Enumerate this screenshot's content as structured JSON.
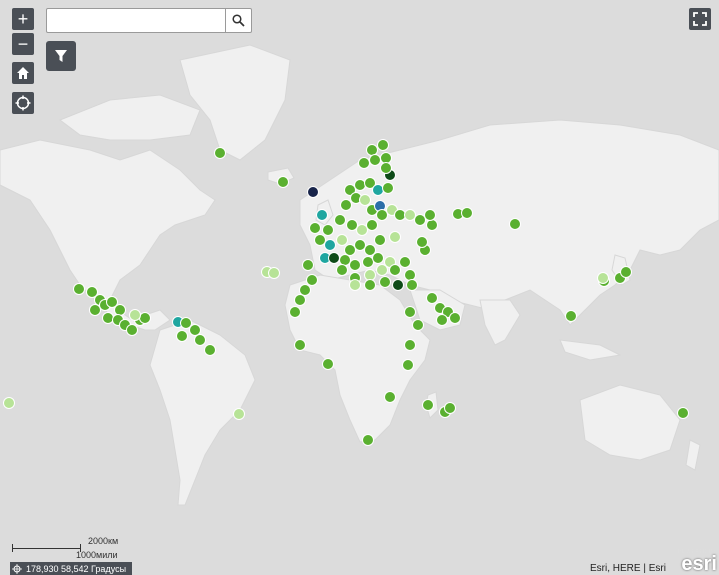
{
  "map": {
    "marker_colors": {
      "primary": "#5ab030",
      "light": "#b7e397",
      "teal": "#1fa6a0",
      "blue": "#2b6ea8",
      "dark": "#0e4b18",
      "navy": "#18244a",
      "outline": "#ffffff"
    },
    "land_color": "#f0f0f0",
    "ocean_color": "#dcdcdc"
  },
  "controls": {
    "zoom_in_label": "+",
    "zoom_out_label": "−",
    "home_icon": "home-icon",
    "locate_icon": "locate-icon",
    "fullscreen_icon": "fullscreen-icon",
    "filter_icon": "filter-icon",
    "search_icon": "search-icon"
  },
  "search": {
    "value": "",
    "placeholder": ""
  },
  "scalebar": {
    "metric_label": "2000км",
    "imperial_label": "1000мили"
  },
  "coordinates": {
    "readout": "178,930 58,542 Градусы"
  },
  "attribution": {
    "text": "Esri, HERE | Esri"
  },
  "logo": {
    "powered_by": "POWERED BY",
    "brand": "esri"
  }
}
